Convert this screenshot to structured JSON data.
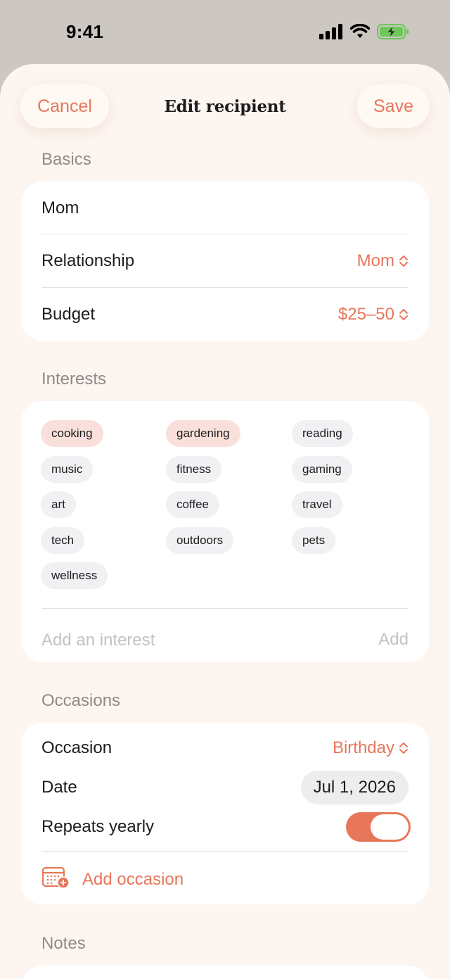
{
  "status_bar": {
    "time": "9:41"
  },
  "nav": {
    "cancel": "Cancel",
    "title": "Edit recipient",
    "save": "Save"
  },
  "basics": {
    "label": "Basics",
    "name": "Mom",
    "relationship_label": "Relationship",
    "relationship_value": "Mom",
    "budget_label": "Budget",
    "budget_value": "$25–50"
  },
  "interests": {
    "label": "Interests",
    "chips": [
      {
        "text": "cooking",
        "selected": true
      },
      {
        "text": "gardening",
        "selected": true
      },
      {
        "text": "reading",
        "selected": false
      },
      {
        "text": "music",
        "selected": false
      },
      {
        "text": "fitness",
        "selected": false
      },
      {
        "text": "gaming",
        "selected": false
      },
      {
        "text": "art",
        "selected": false
      },
      {
        "text": "coffee",
        "selected": false
      },
      {
        "text": "travel",
        "selected": false
      },
      {
        "text": "tech",
        "selected": false
      },
      {
        "text": "outdoors",
        "selected": false
      },
      {
        "text": "pets",
        "selected": false
      },
      {
        "text": "wellness",
        "selected": false
      }
    ],
    "add_placeholder": "Add an interest",
    "add_button": "Add"
  },
  "occasions": {
    "label": "Occasions",
    "occasion_label": "Occasion",
    "occasion_value": "Birthday",
    "date_label": "Date",
    "date_value": "Jul 1, 2026",
    "repeats_label": "Repeats yearly",
    "repeats_on": true,
    "add_label": "Add occasion"
  },
  "notes": {
    "label": "Notes"
  },
  "colors": {
    "accent": "#e8765a",
    "background": "#fdf5f0",
    "chip": "#f1f0f3",
    "chip_selected": "#f9e0da"
  }
}
